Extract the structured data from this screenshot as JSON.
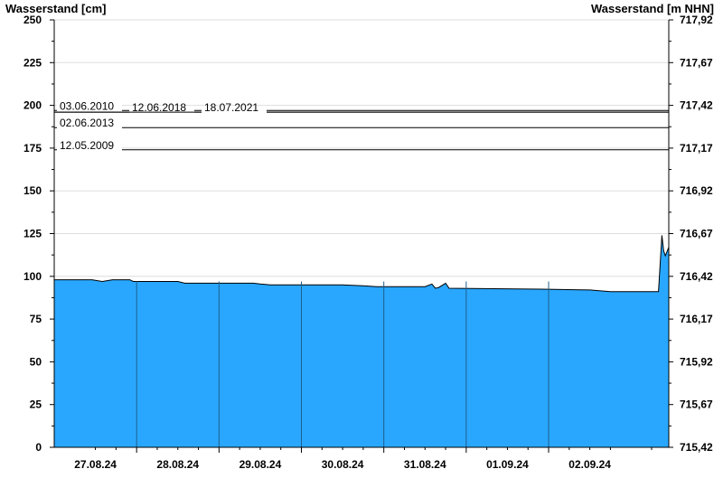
{
  "chart_data": {
    "type": "area",
    "ylabel_left": "Wasserstand [cm]",
    "ylabel_right": "Wasserstand [m NHN]",
    "ylim": [
      0,
      250
    ],
    "yticks_left": [
      "0",
      "25",
      "50",
      "75",
      "100",
      "125",
      "150",
      "175",
      "200",
      "225",
      "250"
    ],
    "yticks_right": [
      "715,42",
      "715,67",
      "715,92",
      "716,17",
      "716,42",
      "716,67",
      "716,92",
      "717,17",
      "717,42",
      "717,67",
      "717,92"
    ],
    "xlim": [
      "2024-08-26T12:00",
      "2024-09-02T23:00"
    ],
    "x_tick_labels": [
      "27.08.24",
      "28.08.24",
      "29.08.24",
      "30.08.24",
      "31.08.24",
      "01.09.24",
      "02.09.24"
    ],
    "day_boundaries": [
      "2024-08-27T12:00",
      "2024-08-28T12:00",
      "2024-08-29T12:00",
      "2024-08-30T12:00",
      "2024-08-31T12:00",
      "2024-09-01T12:00"
    ],
    "grid": true,
    "fill_color": "#29a7ff",
    "reference_lines": [
      {
        "label": "03.06.2010",
        "value": 197
      },
      {
        "label": "12.06.2018",
        "value": 196
      },
      {
        "label": "18.07.2021",
        "value": 196
      },
      {
        "label": "02.06.2013",
        "value": 187
      },
      {
        "label": "12.05.2009",
        "value": 174
      }
    ],
    "series": [
      {
        "points": [
          {
            "x": "2024-08-26T12:00",
            "y": 98
          },
          {
            "x": "2024-08-26T23:00",
            "y": 98
          },
          {
            "x": "2024-08-27T02:00",
            "y": 97
          },
          {
            "x": "2024-08-27T05:00",
            "y": 98
          },
          {
            "x": "2024-08-27T06:00",
            "y": 98
          },
          {
            "x": "2024-08-27T10:00",
            "y": 98
          },
          {
            "x": "2024-08-27T11:00",
            "y": 97
          },
          {
            "x": "2024-08-28T00:00",
            "y": 97
          },
          {
            "x": "2024-08-28T02:00",
            "y": 96
          },
          {
            "x": "2024-08-28T22:00",
            "y": 96
          },
          {
            "x": "2024-08-29T00:00",
            "y": 95.5
          },
          {
            "x": "2024-08-29T03:00",
            "y": 95
          },
          {
            "x": "2024-08-30T00:00",
            "y": 95
          },
          {
            "x": "2024-08-30T06:00",
            "y": 94.5
          },
          {
            "x": "2024-08-30T10:00",
            "y": 94
          },
          {
            "x": "2024-08-31T00:00",
            "y": 94
          },
          {
            "x": "2024-08-31T02:00",
            "y": 95.5
          },
          {
            "x": "2024-08-31T03:00",
            "y": 93
          },
          {
            "x": "2024-08-31T04:00",
            "y": 93.5
          },
          {
            "x": "2024-08-31T06:00",
            "y": 96
          },
          {
            "x": "2024-08-31T07:00",
            "y": 93
          },
          {
            "x": "2024-09-01T10:00",
            "y": 92.5
          },
          {
            "x": "2024-09-02T00:00",
            "y": 92
          },
          {
            "x": "2024-09-02T06:00",
            "y": 91
          },
          {
            "x": "2024-09-02T20:00",
            "y": 91
          },
          {
            "x": "2024-09-02T21:00",
            "y": 124
          },
          {
            "x": "2024-09-02T21:30",
            "y": 115
          },
          {
            "x": "2024-09-02T22:00",
            "y": 112
          },
          {
            "x": "2024-09-02T23:00",
            "y": 117
          }
        ]
      }
    ]
  }
}
